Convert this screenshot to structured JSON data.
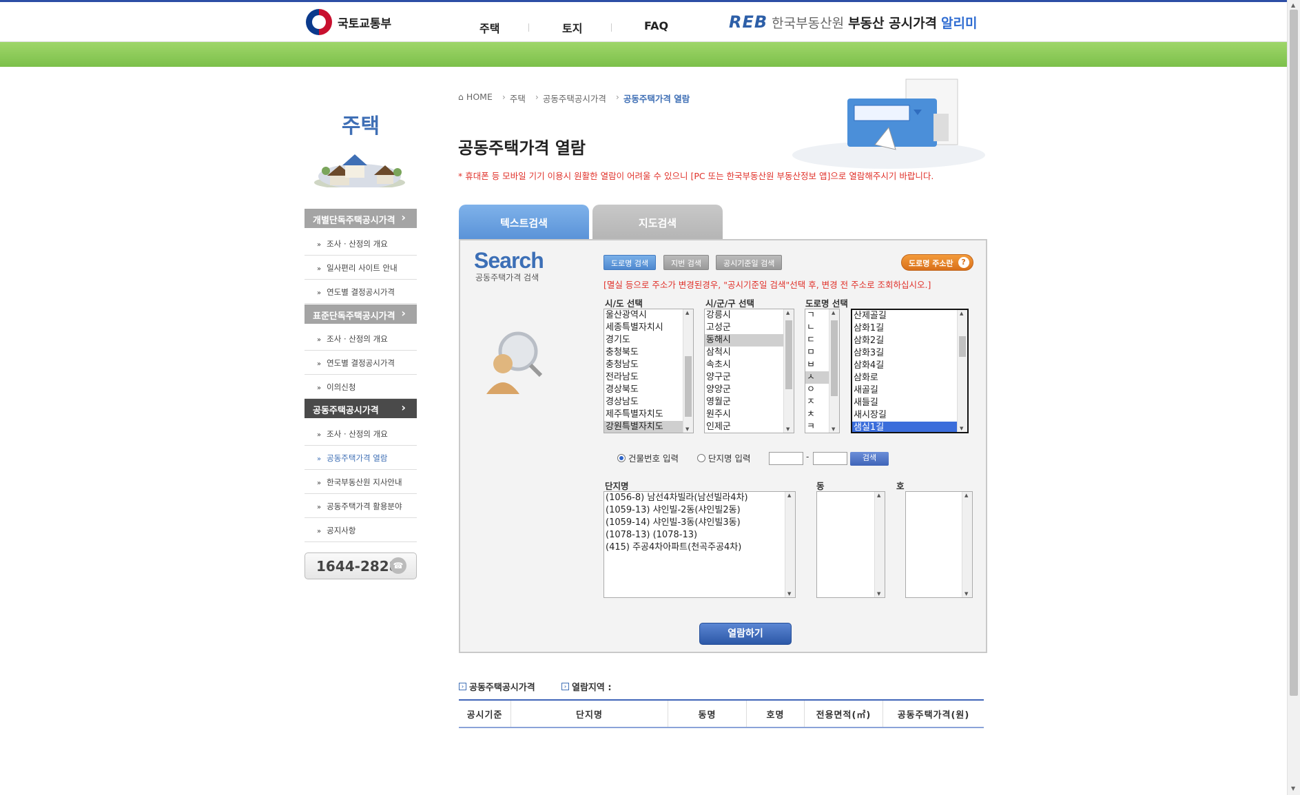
{
  "header": {
    "ministry": "국토교통부",
    "nav": [
      "주택",
      "토지",
      "FAQ"
    ],
    "reb_logo": "REB",
    "reb_name": "한국부동산원",
    "service_name": "부동산 공시가격",
    "service_highlight": "알리미"
  },
  "sidebar": {
    "title": "주택",
    "groups": [
      {
        "label": "개별단독주택공시가격",
        "items": [
          "조사 · 산정의 개요",
          "일사편리 사이트 안내",
          "연도별 결정공시가격"
        ]
      },
      {
        "label": "표준단독주택공시가격",
        "items": [
          "조사 · 산정의 개요",
          "연도별 결정공시가격",
          "이의신청"
        ]
      },
      {
        "label": "공동주택공시가격",
        "items": [
          "조사 · 산정의 개요",
          "공동주택가격 열람",
          "한국부동산원 지사안내",
          "공동주택가격 활용분야",
          "공지사항"
        ]
      }
    ],
    "phone": "1644-2828"
  },
  "breadcrumb": {
    "home": "HOME",
    "c1": "주택",
    "c2": "공동주택공시가격",
    "c3": "공동주택가격 열람"
  },
  "page": {
    "title": "공동주택가격 열람",
    "notice": "* 휴대폰 등 모바일 기기 이용시 원활한 열람이 어려울 수 있으니 [PC 또는 한국부동산원 부동산정보 앱]으로 열람해주시기 바랍니다."
  },
  "tabs": {
    "text": "텍스트검색",
    "map": "지도검색"
  },
  "search": {
    "logo": "Search",
    "subtitle": "공동주택가격 검색",
    "btn_road": "도로명 검색",
    "btn_lot": "지번 검색",
    "btn_date": "공시기준일 검색",
    "btn_road_addr": "도로명 주소란",
    "warning": "[멸실 등으로 주소가 변경된경우, \"공시기준일 검색\"선택 후, 변경 전 주소로 조회하십시오.]",
    "sido_label": "시/도 선택",
    "sido": [
      "울산광역시",
      "세종특별자치시",
      "경기도",
      "충청북도",
      "충청남도",
      "전라남도",
      "경상북도",
      "경상남도",
      "제주특별자치도",
      "강원특별자치도"
    ],
    "sigungu_label": "시/군/구 선택",
    "sigungu": [
      "강릉시",
      "고성군",
      "동해시",
      "삼척시",
      "속초시",
      "양구군",
      "양양군",
      "영월군",
      "원주시",
      "인제군"
    ],
    "road_label": "도로명 선택",
    "initials": [
      "ㄱ",
      "ㄴ",
      "ㄷ",
      "ㅁ",
      "ㅂ",
      "ㅅ",
      "ㅇ",
      "ㅈ",
      "ㅊ",
      "ㅋ"
    ],
    "roads": [
      "산제골길",
      "삼화1길",
      "삼화2길",
      "삼화3길",
      "삼화4길",
      "삼화로",
      "새골길",
      "새들길",
      "새시장길",
      "샘실1길"
    ],
    "radio_building": "건물번호 입력",
    "radio_complex": "단지명 입력",
    "dash": "-",
    "btn_search": "검색",
    "complex_label": "단지명",
    "complexes": [
      "(1056-8) 남선4차빌라(남선빌라4차)",
      "(1059-13) 샤인빌-2동(샤인빌2동)",
      "(1059-14) 샤인빌-3동(샤인빌3동)",
      "(1078-13) (1078-13)",
      "(415) 주공4차아파트(천곡주공4차)"
    ],
    "dong_label": "동",
    "ho_label": "호",
    "btn_view": "열람하기"
  },
  "results": {
    "label1": "공동주택공시가격",
    "label2": "열람지역 :",
    "columns": [
      "공시기준",
      "단지명",
      "동명",
      "호명",
      "전용면적(㎡)",
      "공동주택가격(원)"
    ]
  }
}
